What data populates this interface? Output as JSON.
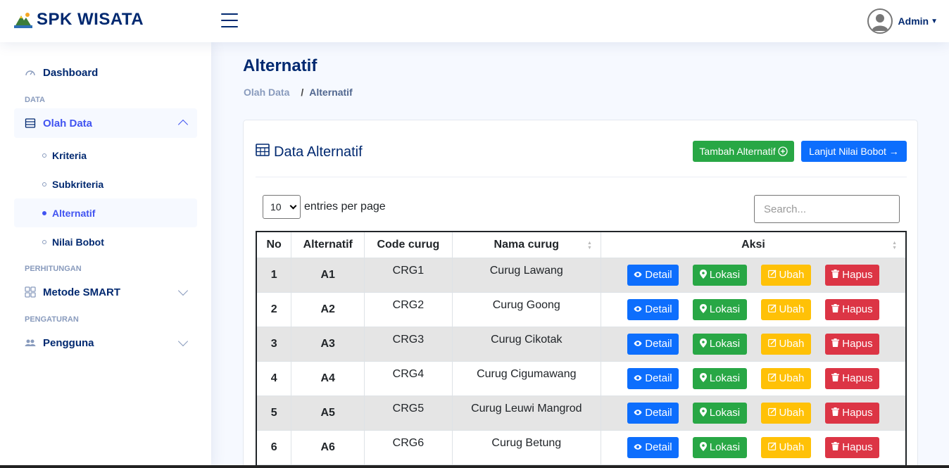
{
  "app": {
    "title": "SPK WISATA"
  },
  "header": {
    "user_name": "Admin"
  },
  "sidebar": {
    "dashboard": "Dashboard",
    "heading_data": "DATA",
    "olah_data": "Olah Data",
    "sub_items": [
      "Kriteria",
      "Subkriteria",
      "Alternatif",
      "Nilai Bobot"
    ],
    "heading_perhitungan": "PERHITUNGAN",
    "metode": "Metode SMART",
    "heading_pengaturan": "PENGATURAN",
    "pengguna": "Pengguna"
  },
  "page": {
    "title": "Alternatif",
    "breadcrumb": [
      "Olah Data",
      "/",
      "Alternatif"
    ]
  },
  "card": {
    "title": "Data Alternatif",
    "add_button": "Tambah Alternatif",
    "next_button": "Lanjut Nilai Bobot →",
    "entries_value": "10",
    "entries_label": "entries per page",
    "search_placeholder": "Search..."
  },
  "table": {
    "headers": [
      "No",
      "Alternatif",
      "Code curug",
      "Nama curug",
      "Aksi"
    ],
    "rows": [
      [
        "1",
        "A1",
        "CRG1",
        "Curug Lawang"
      ],
      [
        "2",
        "A2",
        "CRG2",
        "Curug Goong"
      ],
      [
        "3",
        "A3",
        "CRG3",
        "Curug Cikotak"
      ],
      [
        "4",
        "A4",
        "CRG4",
        "Curug Cigumawang"
      ],
      [
        "5",
        "A5",
        "CRG5",
        "Curug Leuwi Mangrod"
      ],
      [
        "6",
        "A6",
        "CRG6",
        "Curug Betung"
      ]
    ],
    "action_labels": {
      "detail": "Detail",
      "lokasi": "Lokasi",
      "ubah": "Ubah",
      "hapus": "Hapus"
    }
  },
  "colors": {
    "primary": "#0d6efd",
    "success": "#28a745",
    "warning": "#ffc107",
    "danger": "#dc3545",
    "brand": "#012970"
  }
}
